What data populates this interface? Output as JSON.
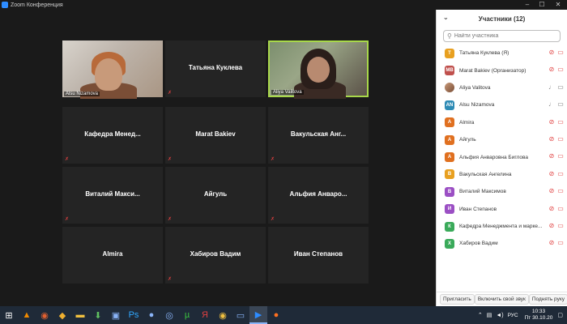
{
  "window": {
    "title": "Zoom Конференция",
    "min": "–",
    "max": "☐",
    "close": "✕"
  },
  "tiles": [
    {
      "name": "Alsu Nizamova",
      "video": true,
      "muted": false
    },
    {
      "name": "Татьяна Куклева",
      "video": false,
      "muted": true
    },
    {
      "name": "Aliya Valitova",
      "video": true,
      "muted": false
    },
    {
      "name": "Кафедра Менед...",
      "video": false,
      "muted": true
    },
    {
      "name": "Marat Bakiev",
      "video": false,
      "muted": true
    },
    {
      "name": "Вакульская Анг...",
      "video": false,
      "muted": true
    },
    {
      "name": "Виталий Макси...",
      "video": false,
      "muted": true
    },
    {
      "name": "Айгуль",
      "video": false,
      "muted": true
    },
    {
      "name": "Альфия Анваро...",
      "video": false,
      "muted": true
    },
    {
      "name": "Almira",
      "video": false,
      "muted": false
    },
    {
      "name": "Хабиров Вадим",
      "video": false,
      "muted": true
    },
    {
      "name": "Иван Степанов",
      "video": false,
      "muted": false
    }
  ],
  "panel": {
    "title": "Участники (12)",
    "search_placeholder": "Найти участника",
    "participants": [
      {
        "initials": "Т",
        "color": "#e8a020",
        "name": "Татьяна Куклева (Я)",
        "mic": "muted",
        "video": "off"
      },
      {
        "initials": "MB",
        "color": "#c0504d",
        "name": "Marat Bakiev (Организатор)",
        "mic": "muted",
        "video": "off"
      },
      {
        "initials": "",
        "color": "#b88a70",
        "name": "Aliya Valitova",
        "mic": "on",
        "video": "on",
        "photo": true
      },
      {
        "initials": "AN",
        "color": "#2e8bb5",
        "name": "Alsu Nizamova",
        "mic": "on",
        "video": "on"
      },
      {
        "initials": "A",
        "color": "#e07020",
        "name": "Almira",
        "mic": "muted",
        "video": "off"
      },
      {
        "initials": "А",
        "color": "#e07020",
        "name": "Айгуль",
        "mic": "muted",
        "video": "off"
      },
      {
        "initials": "А",
        "color": "#e07020",
        "name": "Альфия Анваровна Биглова",
        "mic": "muted",
        "video": "off"
      },
      {
        "initials": "В",
        "color": "#e8a020",
        "name": "Вакульская Ангелина",
        "mic": "muted",
        "video": "off"
      },
      {
        "initials": "В",
        "color": "#9b4fc4",
        "name": "Виталий Максимов",
        "mic": "muted",
        "video": "off"
      },
      {
        "initials": "И",
        "color": "#9b4fc4",
        "name": "Иван Степанов",
        "mic": "muted",
        "video": "off"
      },
      {
        "initials": "К",
        "color": "#3aaa5a",
        "name": "Кафедра Менеджмента и марке...",
        "mic": "muted",
        "video": "off"
      },
      {
        "initials": "Х",
        "color": "#3aaa5a",
        "name": "Хабиров Вадим",
        "mic": "muted",
        "video": "off"
      }
    ],
    "footer": {
      "invite": "Пригласить",
      "unmute": "Включить свой звук",
      "raise_hand": "Поднять руку"
    }
  },
  "taskbar": {
    "lang": "РУС",
    "time": "10:33",
    "date": "Пт 30.10.20"
  }
}
